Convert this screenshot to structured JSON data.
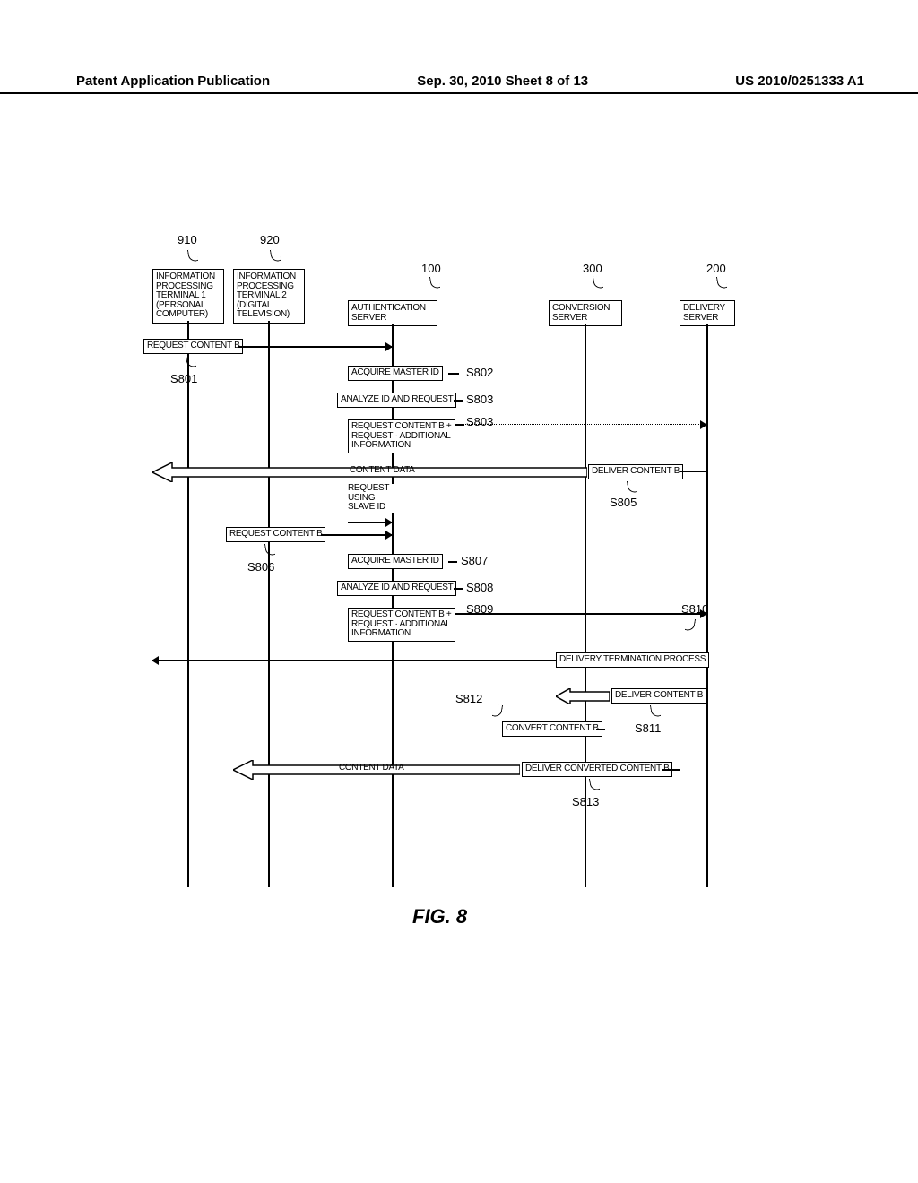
{
  "header": {
    "left": "Patent Application Publication",
    "center": "Sep. 30, 2010  Sheet 8 of 13",
    "right": "US 2010/0251333 A1"
  },
  "figure_caption": "FIG. 8",
  "lanes": {
    "t1": {
      "num": "910",
      "label": "INFORMATION\nPROCESSING\nTERMINAL 1\n(PERSONAL\nCOMPUTER)"
    },
    "t2": {
      "num": "920",
      "label": "INFORMATION\nPROCESSING\nTERMINAL 2\n(DIGITAL\nTELEVISION)"
    },
    "auth": {
      "num": "100",
      "label": "AUTHENTICATION\nSERVER"
    },
    "conv": {
      "num": "300",
      "label": "CONVERSION\nSERVER"
    },
    "del": {
      "num": "200",
      "label": "DELIVERY\nSERVER"
    }
  },
  "steps": {
    "s801": "S801",
    "s802": "S802",
    "s803a": "S803",
    "s803b": "S803",
    "s805": "S805",
    "s806": "S806",
    "s807": "S807",
    "s808": "S808",
    "s809": "S809",
    "s810": "S810",
    "s811": "S811",
    "s812": "S812",
    "s813": "S813"
  },
  "messages": {
    "req_b_1": "REQUEST CONTENT B",
    "acquire_master_1": "ACQUIRE MASTER ID",
    "analyze_1": "ANALYZE ID AND REQUEST",
    "req_b_plus_1": "REQUEST CONTENT B +\nREQUEST · ADDITIONAL\nINFORMATION",
    "content_data_1": "CONTENT DATA",
    "deliver_b_1": "DELIVER CONTENT B",
    "req_slave": "REQUEST\nUSING\nSLAVE ID",
    "req_b_2": "REQUEST CONTENT B",
    "acquire_master_2": "ACQUIRE MASTER ID",
    "analyze_2": "ANALYZE ID AND REQUEST",
    "req_b_plus_2": "REQUEST CONTENT B +\nREQUEST · ADDITIONAL\nINFORMATION",
    "termination": "DELIVERY TERMINATION PROCESS",
    "deliver_b_2": "DELIVER CONTENT B",
    "convert_b": "CONVERT CONTENT B",
    "content_data_2": "CONTENT DATA",
    "deliver_converted": "DELIVER CONVERTED CONTENT B"
  }
}
